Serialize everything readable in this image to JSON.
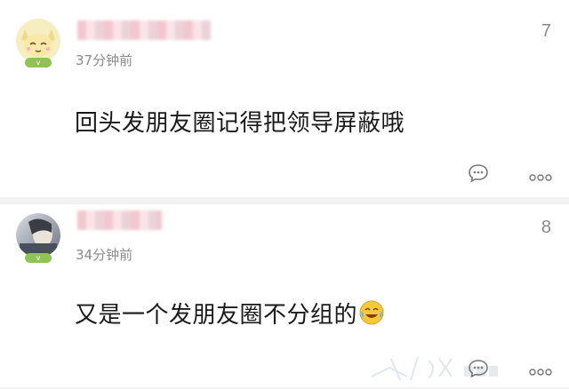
{
  "comments": [
    {
      "username": "",
      "time": "37分钟前",
      "floor": "7",
      "badge": "v",
      "text": "回头发朋友圈记得把领导屏蔽哦",
      "avatar_icon": "cat-avatar-icon"
    },
    {
      "username": "",
      "time": "34分钟前",
      "floor": "8",
      "badge": "v",
      "text": "又是一个发朋友圈不分组的",
      "emoji": "laughing-tears-emoji"
    }
  ],
  "actions": {
    "reply_icon": "comment-bubble-icon",
    "more_icon": "more-dots-icon"
  },
  "colors": {
    "badge": "#8fc454",
    "meta": "#8a8a8a",
    "text": "#1a1a1a",
    "divider": "#f2f2f2"
  }
}
